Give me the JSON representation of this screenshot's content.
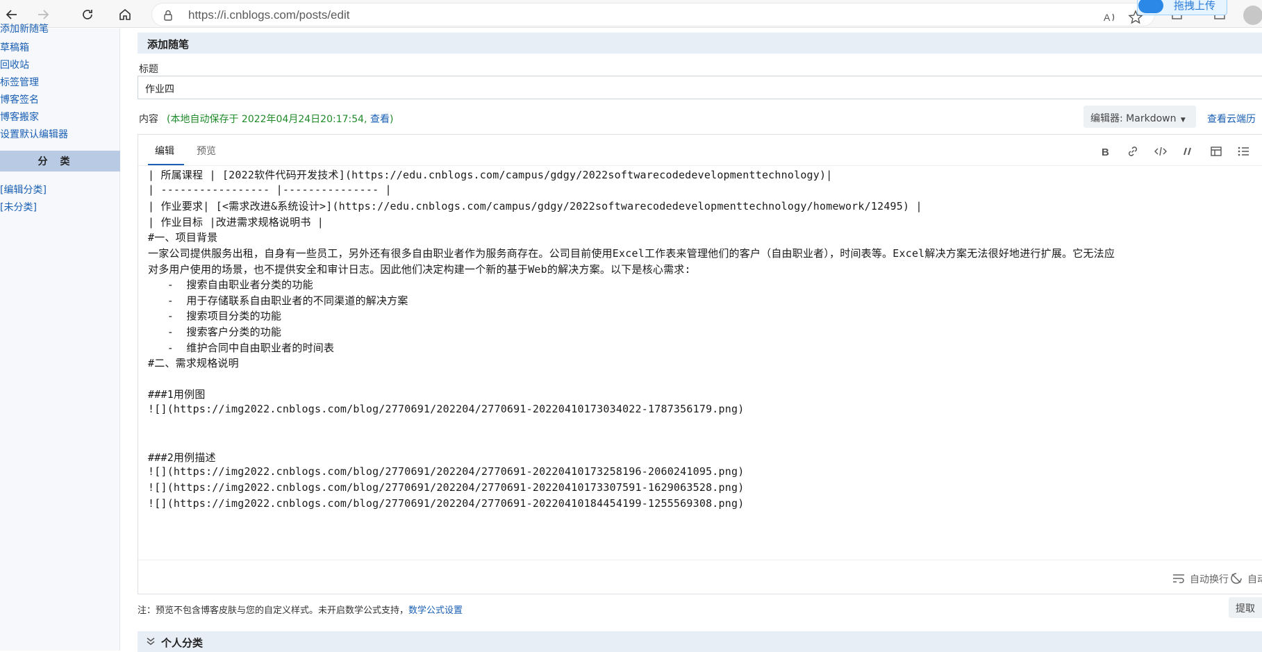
{
  "browser": {
    "url": "https://i.cnblogs.com/posts/edit",
    "upload_badge": "拖拽上传"
  },
  "sidebar": {
    "partial_top": "添加新随笔",
    "links": [
      "草稿箱",
      "回收站",
      "标签管理",
      "博客签名",
      "博客搬家",
      "设置默认编辑器"
    ],
    "category_header": "分类",
    "category_links": [
      "[编辑分类]",
      "[未分类]"
    ]
  },
  "main": {
    "section_title": "添加随笔",
    "title_label": "标题",
    "title_value": "作业四",
    "content_label": "内容",
    "autosave_text": "(本地自动保存于 2022年04月24日20:17:54,",
    "autosave_view": "查看",
    "autosave_close": ")",
    "editor_mode": "编辑器: Markdown",
    "cloud_history": "查看云端历"
  },
  "editor": {
    "tab_edit": "编辑",
    "tab_preview": "预览",
    "lines": [
      "| 所属课程 | [2022软件代码开发技术](https://edu.cnblogs.com/campus/gdgy/2022softwarecodedevelopmenttechnology)|",
      "| ----------------- |--------------- |",
      "| 作业要求| [<需求改进&系统设计>](https://edu.cnblogs.com/campus/gdgy/2022softwarecodedevelopmenttechnology/homework/12495) |",
      "| 作业目标 |改进需求规格说明书 |",
      "#一、项目背景",
      "一家公司提供服务出租，自身有一些员工，另外还有很多自由职业者作为服务商存在。公司目前使用Excel工作表来管理他们的客户（自由职业者），时间表等。Excel解决方案无法很好地进行扩展。它无法应",
      "对多用户使用的场景，也不提供安全和审计日志。因此他们决定构建一个新的基于Web的解决方案。以下是核心需求:",
      "   -  搜索自由职业者分类的功能",
      "   -  用于存储联系自由职业者的不同渠道的解决方案",
      "   -  搜索项目分类的功能",
      "   -  搜索客户分类的功能",
      "   -  维护合同中自由职业者的时间表",
      "#二、需求规格说明",
      "",
      "###1用例图",
      "![](https://img2022.cnblogs.com/blog/2770691/202204/2770691-20220410173034022-1787356179.png)",
      "",
      "",
      "###2用例描述",
      "![](https://img2022.cnblogs.com/blog/2770691/202204/2770691-20220410173258196-2060241095.png)",
      "![](https://img2022.cnblogs.com/blog/2770691/202204/2770691-20220410173307591-1629063528.png)",
      "![](https://img2022.cnblogs.com/blog/2770691/202204/2770691-20220410184454199-1255569308.png)"
    ],
    "status_wrap": "自动换行",
    "status_auto": "自动"
  },
  "footer": {
    "note_text": "注：预览不包含博客皮肤与您的自定义样式。未开启数学公式支持，",
    "note_link": "数学公式设置",
    "fetch_button": "提取",
    "personal_category": "个人分类"
  }
}
